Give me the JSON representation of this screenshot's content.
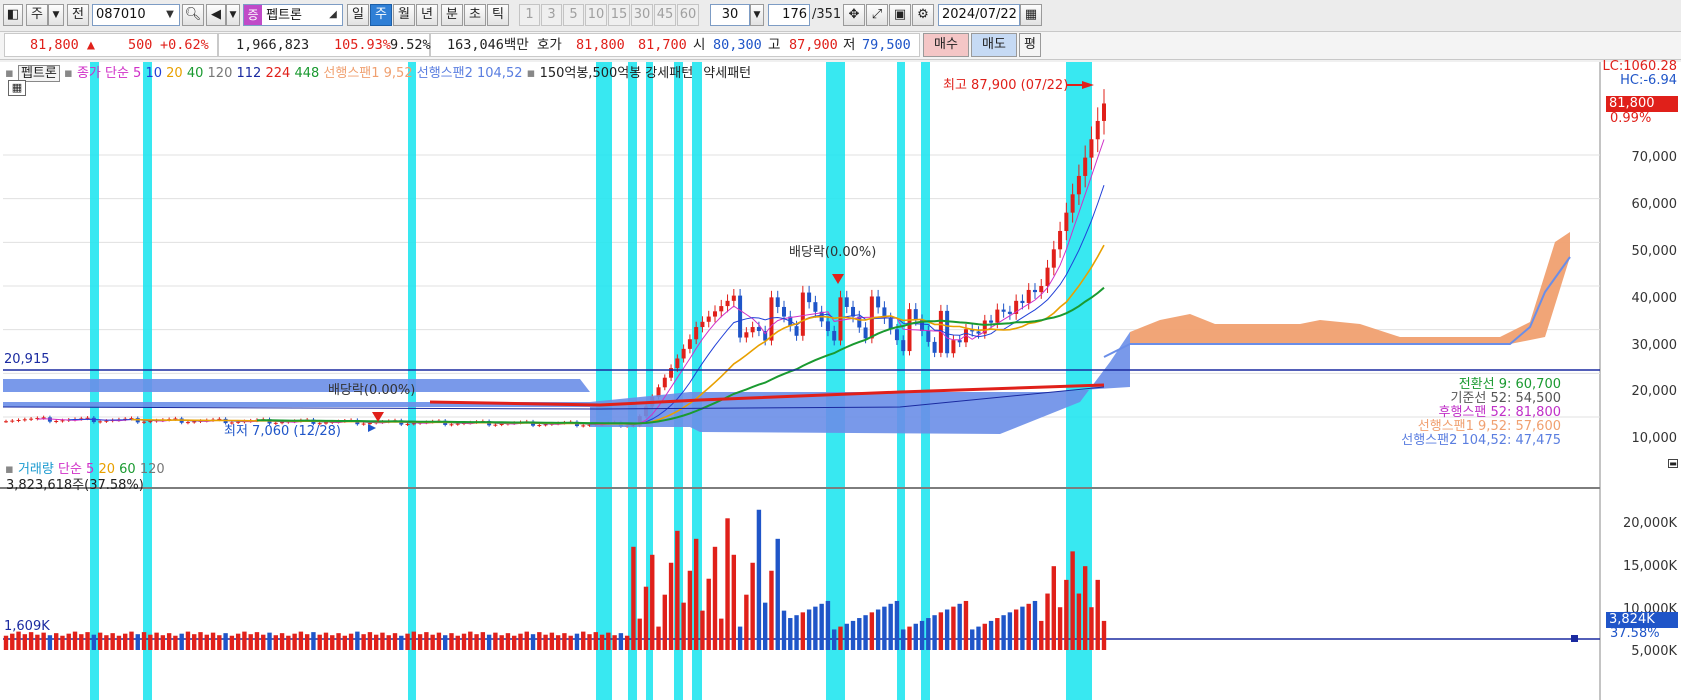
{
  "toolbar": {
    "mode_label": "주",
    "prev_label": "전",
    "code": "087010",
    "stock_badge": "증",
    "stock_name": "펩트론",
    "periods": [
      "일",
      "주",
      "월",
      "년",
      "분",
      "초",
      "틱"
    ],
    "period_selected": "주",
    "minute_options": [
      "1",
      "3",
      "5",
      "10",
      "15",
      "30",
      "45",
      "60"
    ],
    "interval_value": "30",
    "count_value": "176",
    "count_total": "/351",
    "date": "2024/07/22"
  },
  "quote": {
    "price": "81,800 ▲",
    "change": "500",
    "change_pct": "+0.62%",
    "volume": "1,966,823",
    "vol_ratio": "105.93%",
    "turnover": "9.52%",
    "amount": "163,046백만",
    "bid_label": "호가",
    "ask": "81,800",
    "bid": "81,700",
    "open_label": "시",
    "open": "80,300",
    "high_label": "고",
    "high": "87,900",
    "low_label": "저",
    "low": "79,500",
    "buy_label": "매수",
    "sell_label": "매도",
    "eval_label": "평"
  },
  "legend": {
    "stock": "펩트론",
    "close_ma": "종가 단순 5",
    "ma_10": "10",
    "ma_20": "20",
    "ma_40": "40",
    "ma_120": "120",
    "ma_112": "112",
    "ma_224": "224",
    "ma_448": "448",
    "span1": "선행스팬1 9,52",
    "span2": "선행스팬2 104,52",
    "pattern": "150억봉,500억봉 강세패턴",
    "weak": "약세패턴"
  },
  "annotations": {
    "high": "최고 87,900 (07/22)",
    "low": "최저 7,060 (12/28)",
    "dividend": "배당락(0.00%)",
    "hline": "20,915",
    "vol_hline": "1,609K",
    "vol_info": "3,823,618주(37.58%)"
  },
  "right_axis": {
    "lc": "LC:1060.28",
    "hc": "HC:-6.94",
    "price_badge": "81,800",
    "pct": "0.99%",
    "ticks": [
      "70,000",
      "60,000",
      "50,000",
      "40,000",
      "30,000",
      "20,000",
      "10,000"
    ],
    "vol_ticks": [
      "20,000K",
      "15,000K",
      "10,000K",
      "5,000K"
    ],
    "vol_badge": "3,824K",
    "vol_pct": "37.58%"
  },
  "ichimoku": {
    "conversion": "전환선 9: 60,700",
    "base": "기준선 52: 54,500",
    "lagging": "후행스팬 52: 81,800",
    "lead1": "선행스팬1 9,52: 57,600",
    "lead2": "선행스팬2 104,52: 47,475"
  },
  "volume_legend": {
    "label": "거래량",
    "ma": "단순 5",
    "ma_20": "20",
    "ma_60": "60",
    "ma_120": "120"
  },
  "colors": {
    "up": "#e0201a",
    "down": "#1f55c8",
    "highlight": "#22e5f0",
    "cloud_blue": "#6a8ee8",
    "cloud_orange": "#f0a070"
  }
}
